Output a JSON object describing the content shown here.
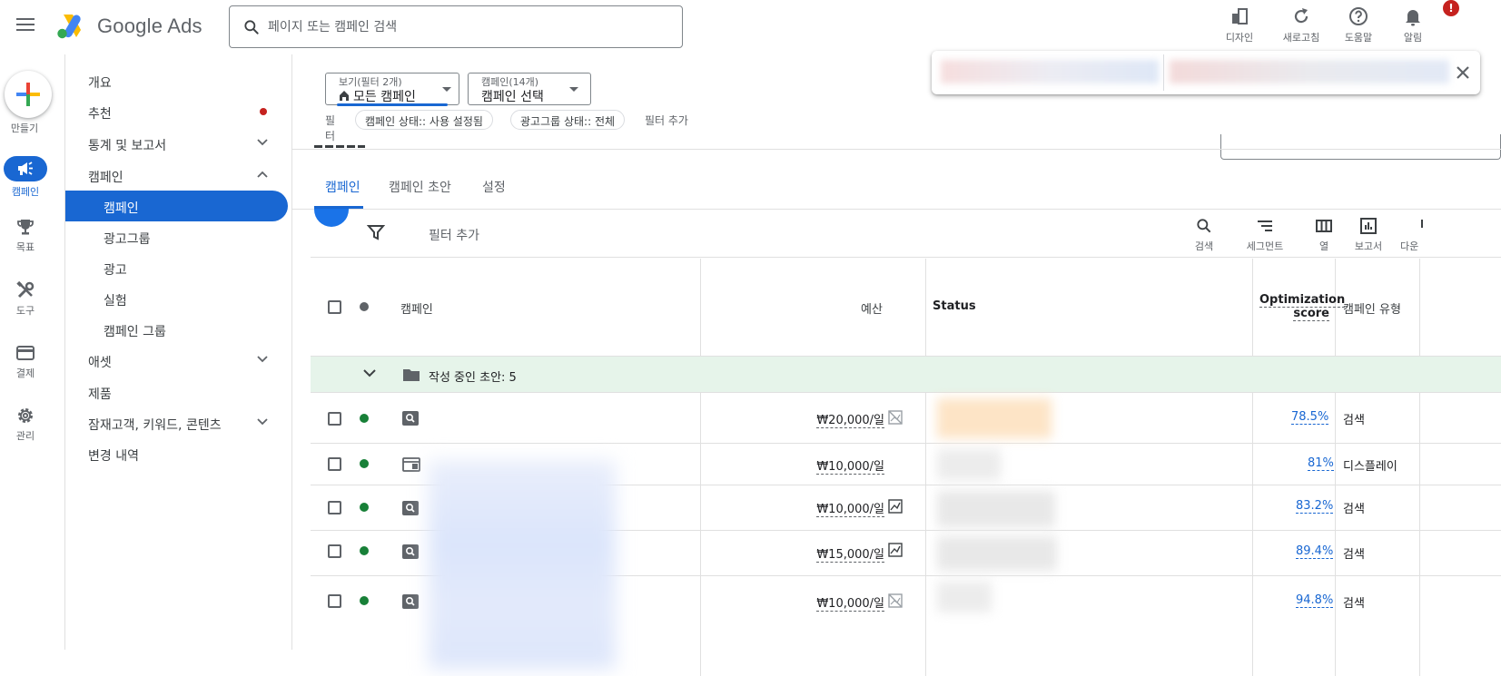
{
  "app": {
    "product": "Google Ads"
  },
  "search": {
    "placeholder": "페이지 또는 캠페인 검색"
  },
  "topbar": {
    "tools": [
      {
        "label": "디자인"
      },
      {
        "label": "새로고침"
      },
      {
        "label": "도움말"
      },
      {
        "label": "알림"
      }
    ],
    "notification_badge": "!"
  },
  "rail": {
    "create": "만들기",
    "items": [
      {
        "label": "캠페인"
      },
      {
        "label": "목표"
      },
      {
        "label": "도구"
      },
      {
        "label": "결제"
      },
      {
        "label": "관리"
      }
    ]
  },
  "nav": {
    "items": [
      {
        "label": "개요"
      },
      {
        "label": "추천"
      },
      {
        "label": "통계 및 보고서"
      },
      {
        "label": "캠페인"
      },
      {
        "label": "캠페인"
      },
      {
        "label": "광고그룹"
      },
      {
        "label": "광고"
      },
      {
        "label": "실험"
      },
      {
        "label": "캠페인 그룹"
      },
      {
        "label": "애셋"
      },
      {
        "label": "제품"
      },
      {
        "label": "잠재고객, 키워드, 콘텐츠"
      },
      {
        "label": "변경 내역"
      }
    ]
  },
  "selectors": {
    "view": {
      "label": "보기(필터 2개)",
      "value": "모든 캠페인"
    },
    "campaign": {
      "label": "캠페인(14개)",
      "value": "캠페인 선택"
    }
  },
  "filters": {
    "label": "필터",
    "chips": [
      "캠페인 상태:: 사용 설정됨",
      "광고그룹 상태:: 전체"
    ],
    "add": "필터 추가"
  },
  "tabs": [
    "캠페인",
    "캠페인 초안",
    "설정"
  ],
  "toolbar": {
    "add_filter": "필터 추가",
    "tools": [
      "검색",
      "세그먼트",
      "열",
      "보고서",
      "다운"
    ]
  },
  "table": {
    "headers": {
      "campaign": "캠페인",
      "budget": "예산",
      "status": "Status",
      "score_line1": "Optimization",
      "score_line2": "score",
      "type": "캠페인 유형"
    },
    "draft_group": "작성 중인 초안: 5",
    "rows": [
      {
        "budget": "₩20,000/일",
        "score": "78.5%",
        "type": "검색",
        "icon": "search-ad-icon"
      },
      {
        "budget": "₩10,000/일",
        "score": "81%",
        "type": "디스플레이",
        "icon": "display-ad-icon"
      },
      {
        "budget": "₩10,000/일",
        "score": "83.2%",
        "type": "검색",
        "icon": "search-ad-icon"
      },
      {
        "budget": "₩15,000/일",
        "score": "89.4%",
        "type": "검색",
        "icon": "search-ad-icon"
      },
      {
        "budget": "₩10,000/일",
        "score": "94.8%",
        "type": "검색",
        "icon": "search-ad-icon"
      }
    ]
  },
  "colors": {
    "accent": "#1967d2",
    "enabled_green": "#188038",
    "alert_red": "#c5221f",
    "draft_row_bg": "#e6f4ea"
  }
}
